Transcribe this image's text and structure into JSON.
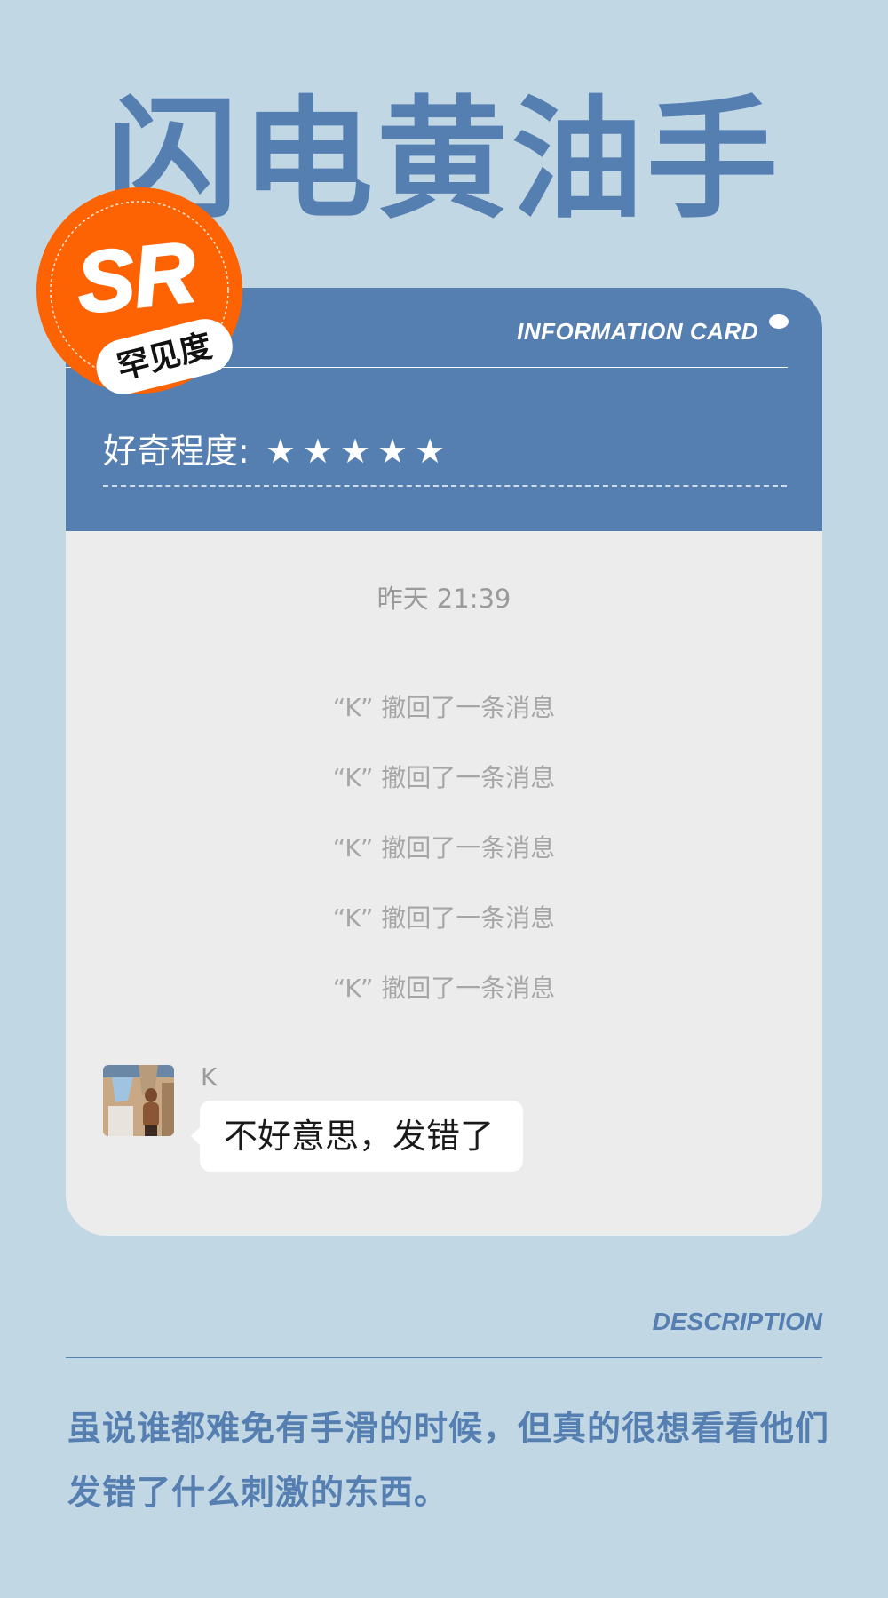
{
  "title": "闪电黄油手",
  "badge": {
    "grade": "SR",
    "rarity_label": "罕见度",
    "color": "#fd6203"
  },
  "card": {
    "header_label": "INFORMATION CARD",
    "curiosity_label": "好奇程度:",
    "curiosity_stars": "★★★★★",
    "curiosity_rating": 5,
    "accent_color": "#557eb1"
  },
  "chat": {
    "timestamp": "昨天 21:39",
    "recalled_messages": [
      "“K” 撤回了一条消息",
      "“K” 撤回了一条消息",
      "“K” 撤回了一条消息",
      "“K” 撤回了一条消息",
      "“K” 撤回了一条消息"
    ],
    "sender": "K",
    "message": "不好意思，发错了"
  },
  "description": {
    "label": "DESCRIPTION",
    "text": "虽说谁都难免有手滑的时候，但真的很想看看他们发错了什么刺激的东西。"
  }
}
